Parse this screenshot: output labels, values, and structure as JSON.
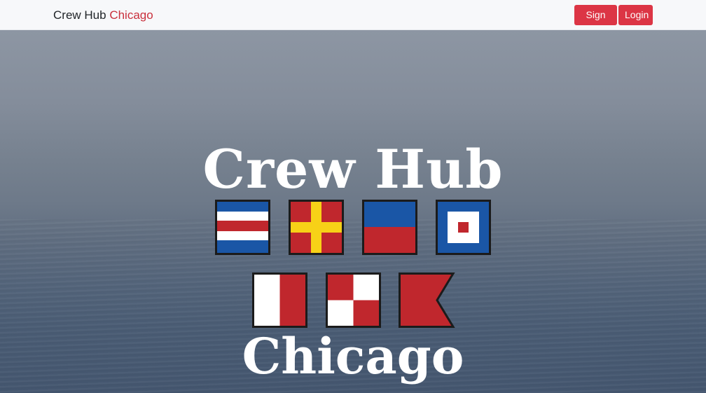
{
  "navbar": {
    "brand_main": "Crew Hub",
    "brand_accent": "Chicago",
    "signup_label": "Sign Up",
    "login_label": "Login"
  },
  "hero": {
    "title_top": "Crew Hub",
    "title_bottom": "Chicago"
  },
  "flags": [
    {
      "icon": "signal-flag-c-icon"
    },
    {
      "icon": "signal-flag-r-icon"
    },
    {
      "icon": "signal-flag-e-icon"
    },
    {
      "icon": "signal-flag-w-icon"
    },
    {
      "icon": "signal-flag-h-icon"
    },
    {
      "icon": "signal-flag-u-icon"
    },
    {
      "icon": "signal-flag-b-icon"
    }
  ],
  "colors": {
    "accent": "#dc3545",
    "navbar_bg": "#f7f8fa",
    "flag_red": "#c0272d",
    "flag_blue": "#1a56a6",
    "flag_yellow": "#f7d117"
  }
}
